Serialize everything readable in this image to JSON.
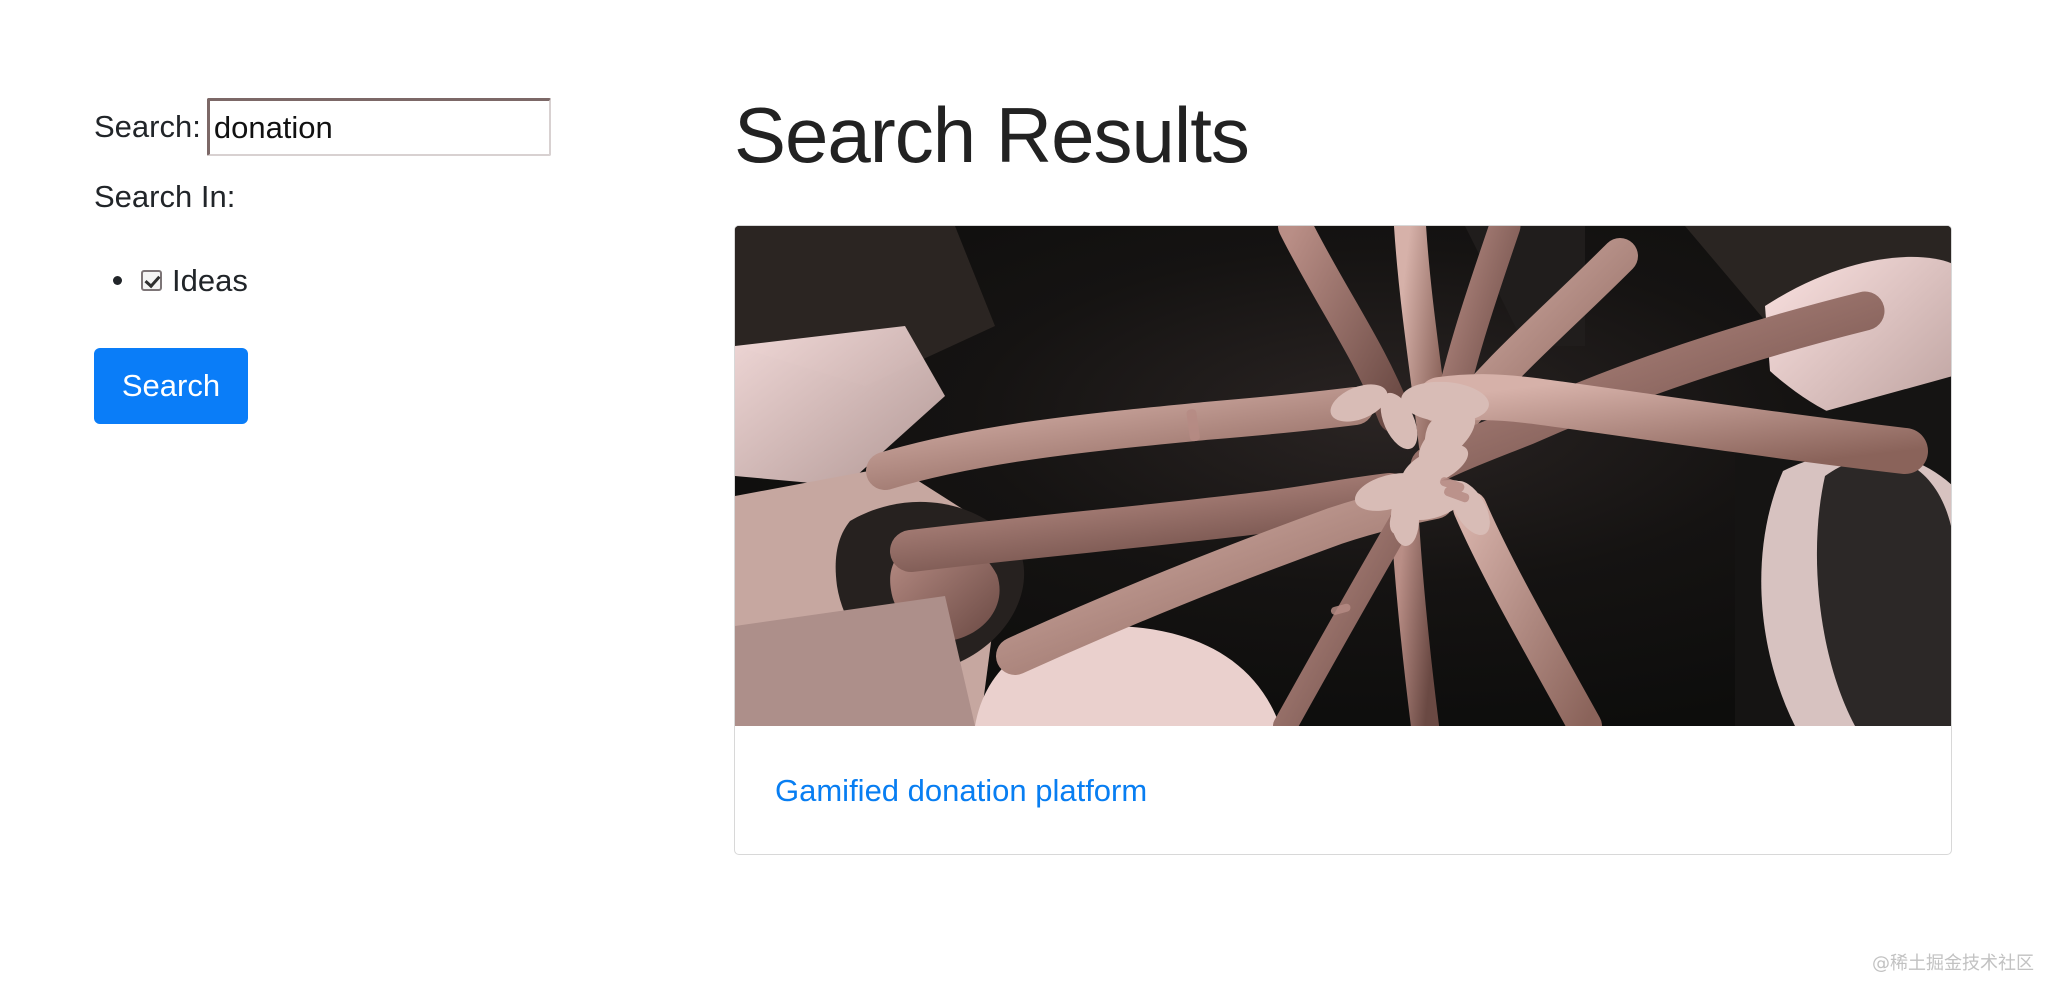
{
  "sidebar": {
    "search_label": "Search:",
    "search_value": "donation",
    "search_in_label": "Search In:",
    "filters": [
      {
        "label": "Ideas",
        "checked": true
      }
    ],
    "search_button_label": "Search"
  },
  "results": {
    "title": "Search Results",
    "items": [
      {
        "image_icon": "team-hands-photo",
        "title": "Gamified donation platform"
      }
    ]
  },
  "watermark": "@稀土掘金技术社区",
  "colors": {
    "primary": "#0a7df8",
    "link": "#087ef2",
    "text": "#212529"
  }
}
